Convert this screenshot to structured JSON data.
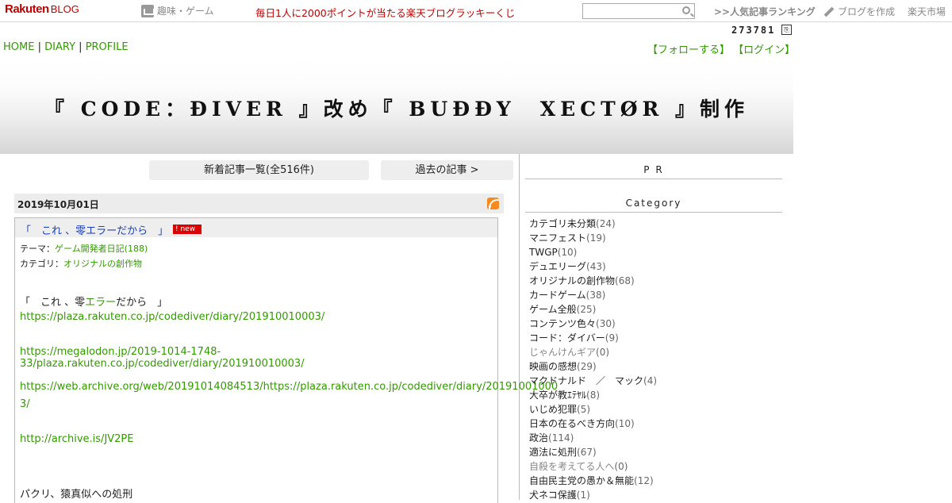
{
  "topbar": {
    "brand": "Rakuten",
    "blog": "BLOG",
    "category": "趣味・ゲーム",
    "promo": "毎日1人に2000ポイントが当たる楽天ブログラッキーくじ",
    "search_placeholder": "",
    "ranking": ">>人気記事ランキング",
    "make_blog": "ブログを作成",
    "ichiba": "楽天市場"
  },
  "counter": "273781",
  "nav": {
    "home": "HOME",
    "diary": "DIARY",
    "profile": "PROFILE",
    "sep": "|"
  },
  "follow": {
    "follow": "【フォローする】",
    "login": "【ログイン】"
  },
  "header_title": "『 CODE：ĐIVER 』改め『 BUĐĐY　XECTØR 』制作",
  "buttons": {
    "new_list": "新着記事一覧(全516件)",
    "past": "過去の記事 >"
  },
  "date": "2019年10月01日",
  "article": {
    "title": "「　これ 、零エラーだから　」",
    "new_badge": "new",
    "theme_label": "テーマ：",
    "theme": "ゲーム開発者日記(188)",
    "category_label": "カテゴリ：",
    "category": "オリジナルの創作物",
    "line1_pre": "「　これ 、零",
    "line1_green": "エラー",
    "line1_post": "だから　」",
    "link1": "https://plaza.rakuten.co.jp/codediver/diary/201910010003/",
    "link2": "https://megalodon.jp/2019-1014-1748-33/plaza.rakuten.co.jp/codediver/diary/201910010003/",
    "link3a": "https://web.archive.org/web/20191014084513/https://plaza.rakuten.co.jp/codediver/diary/20191001000",
    "link3b": "3/",
    "link4": "http://archive.is/JV2PE",
    "line_last": "パクリ、猿真似への処刑"
  },
  "sidebar": {
    "pr": "P R",
    "category_heading": "Category",
    "categories": [
      {
        "name": "カテゴリ未分類",
        "count": "(24)"
      },
      {
        "name": "マニフェスト",
        "count": "(19)"
      },
      {
        "name": "TWGP",
        "count": "(10)"
      },
      {
        "name": "デュエリーグ",
        "count": "(43)"
      },
      {
        "name": "オリジナルの創作物",
        "count": "(68)"
      },
      {
        "name": "カードゲーム",
        "count": "(38)"
      },
      {
        "name": "ゲーム全般",
        "count": "(25)"
      },
      {
        "name": "コンテンツ色々",
        "count": "(30)"
      },
      {
        "name": "コード：ダイバー",
        "count": "(9)"
      },
      {
        "name": "じゃんけんギア",
        "count": "(0)"
      },
      {
        "name": "映画の感想",
        "count": "(29)"
      },
      {
        "name": "マクドナルド　／　マック",
        "count": "(4)"
      },
      {
        "name": "大卒が教ｴﾃﾔﾙ",
        "count": "(8)"
      },
      {
        "name": "いじめ犯罪",
        "count": "(5)"
      },
      {
        "name": "日本の在るべき方向",
        "count": "(10)"
      },
      {
        "name": "政治",
        "count": "(114)"
      },
      {
        "name": "適法に処刑",
        "count": "(67)"
      },
      {
        "name": "自殺を考えてる人へ",
        "count": "(0)"
      },
      {
        "name": "自由民主党の愚か＆無能",
        "count": "(12)"
      },
      {
        "name": "犬ネコ保護",
        "count": "(1)"
      }
    ]
  }
}
